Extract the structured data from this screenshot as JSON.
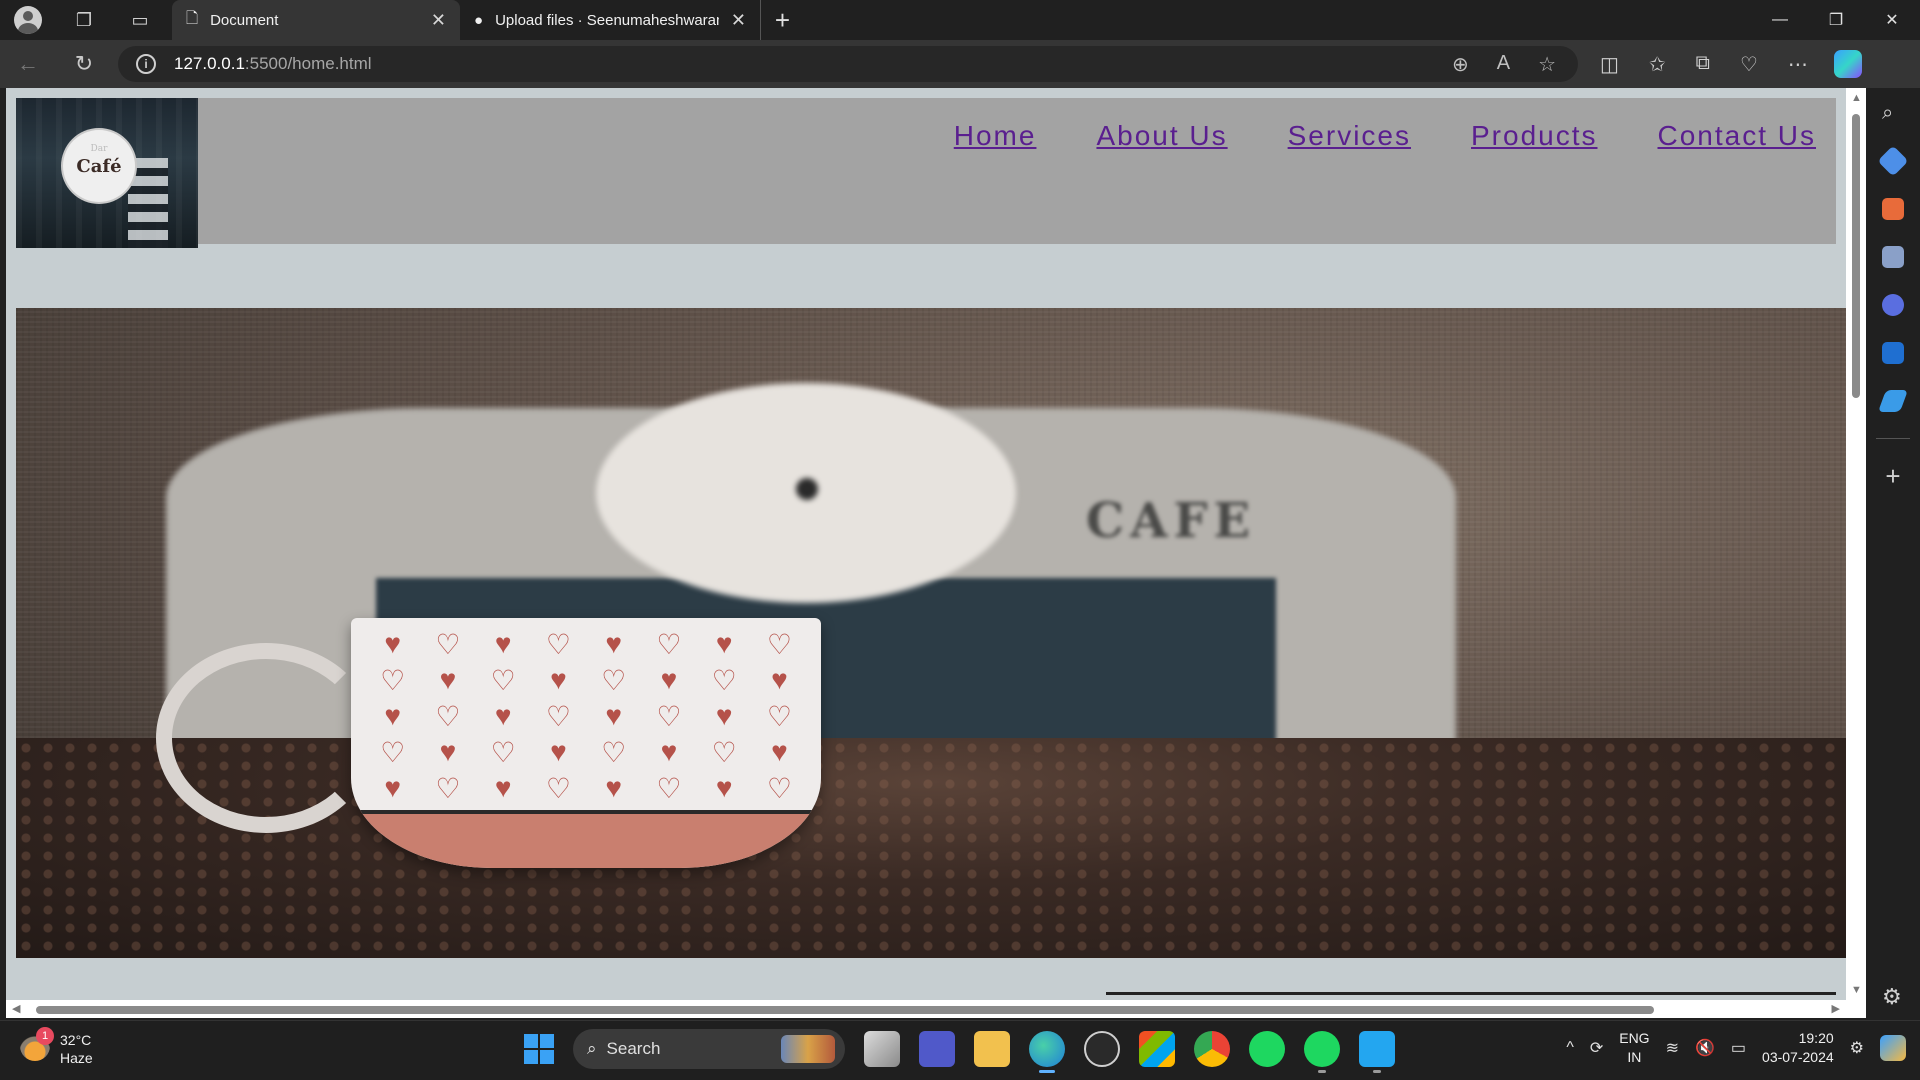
{
  "browser": {
    "tabs": [
      {
        "title": "Document",
        "active": true
      },
      {
        "title": "Upload files · Seenumaheshwaran",
        "active": false
      }
    ],
    "url_host": "127.0.0.1",
    "url_path": ":5500/home.html"
  },
  "site": {
    "logo_text": "Café",
    "logo_subtext": "Dar",
    "nav": [
      "Home",
      "About Us",
      "Services",
      "Products",
      "Contact Us"
    ],
    "hero_sign_text": "CAFE",
    "nav_color": "#5a1f8f",
    "header_bg": "#a3a3a3",
    "page_bg": "#c6ced1"
  },
  "taskbar": {
    "weather_temp": "32°C",
    "weather_desc": "Haze",
    "weather_badge": "1",
    "search_label": "Search",
    "lang_line1": "ENG",
    "lang_line2": "IN",
    "time": "19:20",
    "date": "03-07-2024"
  }
}
